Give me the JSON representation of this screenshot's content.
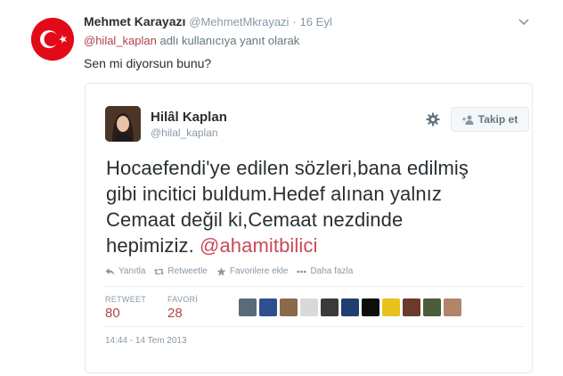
{
  "tweet": {
    "author_name": "Mehmet Karayazı",
    "author_handle": "@MehmetMkrayazi",
    "separator": "·",
    "date": "16 Eyl",
    "reply_to_mention": "@hilal_kaplan",
    "reply_to_text": " adlı kullanıcıya yanıt olarak",
    "text": "Sen mi diyorsun bunu?"
  },
  "quoted": {
    "author_name": "Hilâl Kaplan",
    "author_handle": "@hilal_kaplan",
    "follow_label": "Takip et",
    "text_line1": "Hocaefendi'ye edilen sözleri,bana edilmiş",
    "text_line2": "gibi incitici buldum.Hedef alınan yalnız",
    "text_line3": "Cemaat değil ki,Cemaat nezdinde",
    "text_line4_prefix": "hepimiziz. ",
    "text_mention": "@ahamitbilici",
    "actions": {
      "reply": "Yanıtla",
      "retweet": "Retweetle",
      "favorite": "Favorilere ekle",
      "more": "Daha fazla"
    },
    "stats": {
      "retweet_label": "RETWEET",
      "retweet_count": "80",
      "favorite_label": "FAVORİ",
      "favorite_count": "28"
    },
    "timestamp": "14:44 - 14 Tem 2013"
  },
  "colors": {
    "mention": "#b0434b",
    "muted": "#8899a6",
    "text": "#292f33",
    "border": "#e1e8ed",
    "flag_red": "#e30a17"
  },
  "icons": {
    "caret": "chevron-down-icon",
    "gear": "gear-icon",
    "follow": "add-user-icon",
    "reply": "reply-icon",
    "retweet": "retweet-icon",
    "favorite": "star-icon",
    "more": "more-dots-icon"
  }
}
